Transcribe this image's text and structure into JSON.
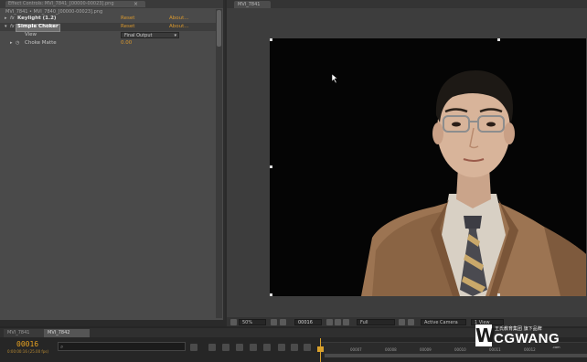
{
  "left_panel": {
    "tab_label": "Effect Controls: MVI_7841_[00000-00023].png",
    "breadcrumb": "MVI_7841 • MVI_7840_[00000-00023].png",
    "effects": [
      {
        "twirl": "▸",
        "fx": "fx",
        "label": "Keylight (1.2)",
        "reset": "Reset",
        "about": "About..."
      },
      {
        "twirl": "▾",
        "fx": "fx",
        "label": "Simple Choker",
        "reset": "Reset",
        "about": "About..."
      }
    ],
    "view": {
      "label": "View",
      "value": "Final Output"
    },
    "choke_matte": {
      "label": "Choke Matte",
      "value": "0.00"
    }
  },
  "viewer": {
    "tab_label": "MVI_7841",
    "toolbar": {
      "zoom": "50%",
      "timecode": "00016",
      "resolution": "Full",
      "camera": "Active Camera",
      "views": "1 View"
    }
  },
  "timeline": {
    "tabs": [
      "MVI_7841",
      "MVI_7842"
    ],
    "timecode": "00016",
    "timecode_sub": "0:00:00:16 (25.00 fps)",
    "search_placeholder": "",
    "ruler_ticks": [
      "00007",
      "00008",
      "00009",
      "00010",
      "00011",
      "00012"
    ]
  },
  "watermark": {
    "logo_letter": "W",
    "small_text": "王氏教育集团 旗下品牌",
    "name": "CGWANG",
    "sub": ".com"
  },
  "colors": {
    "accent_orange": "#d9982e",
    "panel": "#4a4a4a",
    "background": "#2a2a2a"
  }
}
